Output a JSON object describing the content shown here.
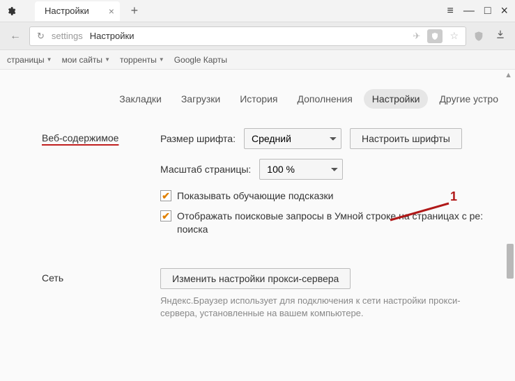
{
  "titlebar": {
    "tab_title": "Настройки"
  },
  "addr": {
    "url_prefix": "settings",
    "url_label": "Настройки"
  },
  "bookmarks": {
    "items": [
      "страницы",
      "мои сайты",
      "торренты",
      "Google Карты"
    ]
  },
  "sections": {
    "tabs": [
      "Закладки",
      "Загрузки",
      "История",
      "Дополнения",
      "Настройки",
      "Другие устро"
    ]
  },
  "web": {
    "heading": "Веб-содержимое",
    "font_size_label": "Размер шрифта:",
    "font_size_value": "Средний",
    "font_button": "Настроить шрифты",
    "zoom_label": "Масштаб страницы:",
    "zoom_value": "100 %",
    "hints_check": "Показывать обучающие подсказки",
    "search_check": "Отображать поисковые запросы в Умной строке на страницах с ре: поиска"
  },
  "network": {
    "heading": "Сеть",
    "proxy_button": "Изменить настройки прокси-сервера",
    "hint": "Яндекс.Браузер использует для подключения к сети настройки прокси-сервера, установленные на вашем компьютере."
  },
  "annotation": {
    "num": "1"
  }
}
